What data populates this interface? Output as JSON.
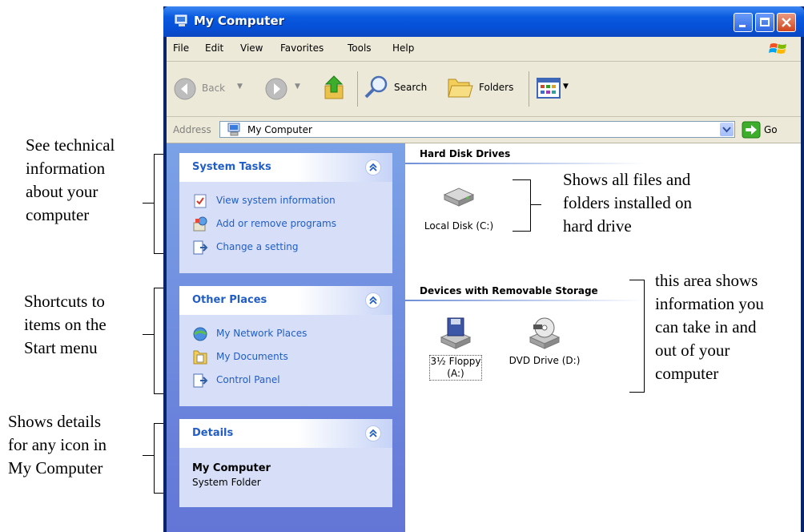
{
  "window": {
    "title": "My Computer",
    "menu": [
      "File",
      "Edit",
      "View",
      "Favorites",
      "Tools",
      "Help"
    ],
    "toolbar": {
      "back": "Back",
      "search": "Search",
      "folders": "Folders"
    },
    "address": {
      "label": "Address",
      "value": "My Computer",
      "go": "Go"
    }
  },
  "left_pane": {
    "system_tasks": {
      "title": "System Tasks",
      "items": [
        "View system information",
        "Add or remove programs",
        "Change a setting"
      ]
    },
    "other_places": {
      "title": "Other Places",
      "items": [
        "My Network Places",
        "My Documents",
        "Control Panel"
      ]
    },
    "details": {
      "title": "Details",
      "name": "My Computer",
      "type": "System Folder"
    }
  },
  "right_pane": {
    "hard_disk_drives": {
      "title": "Hard Disk Drives",
      "drives": [
        "Local Disk (C:)"
      ]
    },
    "removable": {
      "title": "Devices with Removable Storage",
      "floppy_line1": "3½ Floppy",
      "floppy_line2": "(A:)",
      "dvd": "DVD Drive (D:)"
    }
  },
  "annotations": {
    "system_tasks": [
      "See technical",
      "information",
      "about your",
      "computer"
    ],
    "other_places": [
      "Shortcuts to",
      "items on the",
      "Start menu"
    ],
    "details": [
      "Shows details",
      "for any icon in",
      "My Computer"
    ],
    "hard_drives": [
      "Shows all files and",
      "folders installed on",
      "hard drive"
    ],
    "removable": [
      "this area shows",
      "information you",
      "can take in and",
      "out of your",
      "computer"
    ]
  },
  "colors": {
    "title_bar": "#0a5ae0",
    "task_pane": "#7ba2e7",
    "link": "#215dc6",
    "panel": "#d6dff7"
  }
}
